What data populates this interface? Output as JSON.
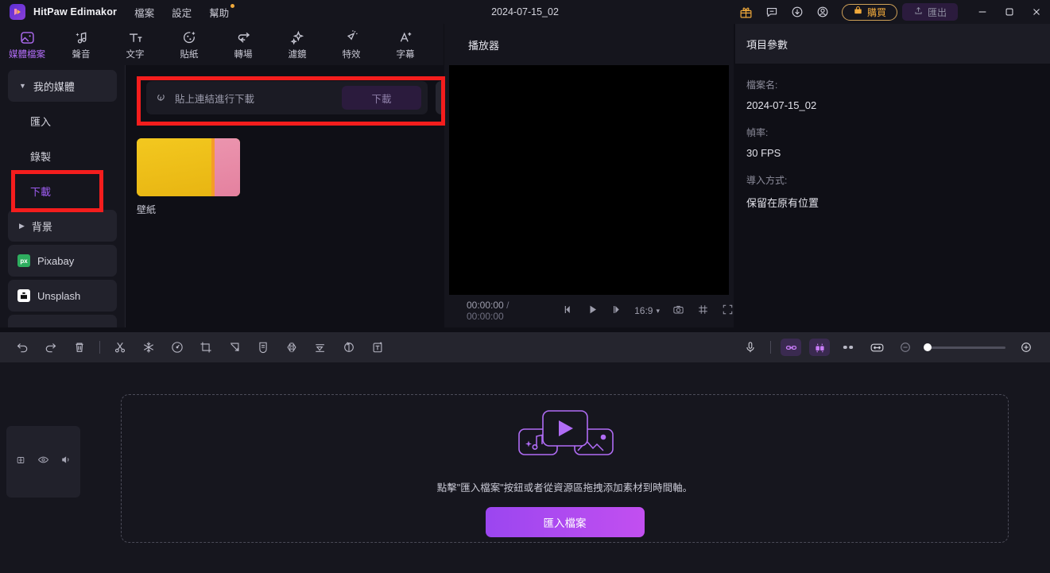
{
  "titlebar": {
    "app_name": "HitPaw Edimakor",
    "logo_icon": "hitpaw-logo-icon",
    "menus": [
      {
        "label": "檔案",
        "icon": "menu-file"
      },
      {
        "label": "設定",
        "icon": "menu-settings"
      },
      {
        "label": "幫助",
        "icon": "menu-help",
        "badge": true
      }
    ],
    "document_title": "2024-07-15_02",
    "icons": [
      {
        "name": "gift-icon",
        "color": "#f0a93b"
      },
      {
        "name": "feedback-icon"
      },
      {
        "name": "download-icon"
      },
      {
        "name": "account-icon"
      }
    ],
    "buy_label": "購買",
    "buy_icon": "cart-icon",
    "buy_color": "#f0a93b",
    "export_label": "匯出",
    "export_icon": "upload-icon",
    "window_buttons": [
      "minimize-icon",
      "maximize-icon",
      "close-icon"
    ]
  },
  "tabs": [
    {
      "label": "媒體檔案",
      "icon": "media-icon",
      "active": true
    },
    {
      "label": "聲音",
      "icon": "audio-icon",
      "active": false
    },
    {
      "label": "文字",
      "icon": "text-icon",
      "active": false
    },
    {
      "label": "貼紙",
      "icon": "sticker-icon",
      "active": false
    },
    {
      "label": "轉場",
      "icon": "transition-icon",
      "active": false
    },
    {
      "label": "濾鏡",
      "icon": "filter-icon",
      "active": false
    },
    {
      "label": "特效",
      "icon": "effect-icon",
      "active": false
    },
    {
      "label": "字幕",
      "icon": "caption-icon",
      "active": false
    }
  ],
  "sidebar": {
    "items": [
      {
        "label": "我的媒體",
        "type": "group",
        "expanded": true,
        "caret": "▼"
      },
      {
        "label": "匯入",
        "type": "sub",
        "active": false
      },
      {
        "label": "錄製",
        "type": "sub",
        "active": false
      },
      {
        "label": "下載",
        "type": "sub",
        "active": true,
        "highlighted": true
      },
      {
        "label": "背景",
        "type": "group",
        "expanded": false,
        "caret": "▶"
      },
      {
        "label": "Pixabay",
        "type": "plain",
        "icon": "pixabay-icon",
        "badge_text": "px"
      },
      {
        "label": "Unsplash",
        "type": "plain",
        "icon": "unsplash-icon"
      }
    ]
  },
  "media_panel": {
    "download_bar": {
      "icon": "link-icon",
      "placeholder": "貼上連結進行下載",
      "button_label": "下載"
    },
    "sort_icon": "sort-list-icon",
    "items": [
      {
        "label": "壁紙",
        "thumb": "wallpaper-thumbnail"
      }
    ]
  },
  "player": {
    "title": "播放器",
    "current_time": "00:00:00",
    "total_time": "00:00:00",
    "separator": "/",
    "controls": [
      {
        "name": "prev-frame-button",
        "icon": "prev-frame-icon"
      },
      {
        "name": "play-button",
        "icon": "play-icon"
      },
      {
        "name": "next-frame-button",
        "icon": "next-frame-icon"
      }
    ],
    "aspect_ratio": "16:9",
    "aspect_caret": "▾",
    "right_controls": [
      {
        "name": "snapshot-button",
        "icon": "camera-icon"
      },
      {
        "name": "grid-button",
        "icon": "grid-icon"
      },
      {
        "name": "fullscreen-button",
        "icon": "fullscreen-icon"
      }
    ]
  },
  "properties": {
    "title": "項目參數",
    "fields": [
      {
        "label": "檔案名:",
        "value": "2024-07-15_02"
      },
      {
        "label": "幀率:",
        "value": "30 FPS"
      },
      {
        "label": "導入方式:",
        "value": "保留在原有位置"
      }
    ]
  },
  "timeline_toolbar": {
    "left_icons": [
      {
        "name": "undo-button",
        "icon": "undo-icon"
      },
      {
        "name": "redo-button",
        "icon": "redo-icon"
      },
      {
        "name": "delete-button",
        "icon": "trash-icon"
      },
      {
        "name": "split-button",
        "icon": "scissors-icon"
      },
      {
        "name": "freeze-frame-button",
        "icon": "snowflake-icon"
      },
      {
        "name": "speed-button",
        "icon": "speedometer-icon"
      },
      {
        "name": "crop-button",
        "icon": "crop-icon"
      },
      {
        "name": "export-frame-button",
        "icon": "arrow-corner-icon"
      },
      {
        "name": "mask-button",
        "icon": "mask-icon"
      },
      {
        "name": "mirror-button",
        "icon": "mirror-icon"
      },
      {
        "name": "align-button",
        "icon": "align-icon"
      },
      {
        "name": "rotate-button",
        "icon": "rotate-icon"
      },
      {
        "name": "add-text-button",
        "icon": "add-text-icon"
      }
    ],
    "right_icons": [
      {
        "name": "record-voice-button",
        "icon": "microphone-icon",
        "active": false
      },
      {
        "name": "link-tracks-button",
        "icon": "link-chain-icon",
        "active": true
      },
      {
        "name": "snap-button",
        "icon": "magnet-icon",
        "active": true
      },
      {
        "name": "split-view-button",
        "icon": "split-view-icon",
        "active": false
      },
      {
        "name": "fit-timeline-button",
        "icon": "fit-width-icon",
        "active": false
      }
    ],
    "zoom_out_icon": "zoom-out-icon",
    "zoom_in_icon": "zoom-in-icon",
    "zoom_value": 0
  },
  "timeline": {
    "track_header_icons": [
      {
        "name": "lock-icon"
      },
      {
        "name": "eye-icon"
      },
      {
        "name": "speaker-icon"
      }
    ],
    "empty_state": {
      "illustration": "media-cards-illustration",
      "hint": "點擊\"匯入檔案\"按鈕或者從資源區拖拽添加素材到時間軸。",
      "button_label": "匯入檔案"
    }
  },
  "annotations": {
    "highlight_color": "#f41d1d",
    "boxes": [
      {
        "name": "download-bar-highlight"
      },
      {
        "name": "sidebar-download-highlight"
      }
    ]
  }
}
